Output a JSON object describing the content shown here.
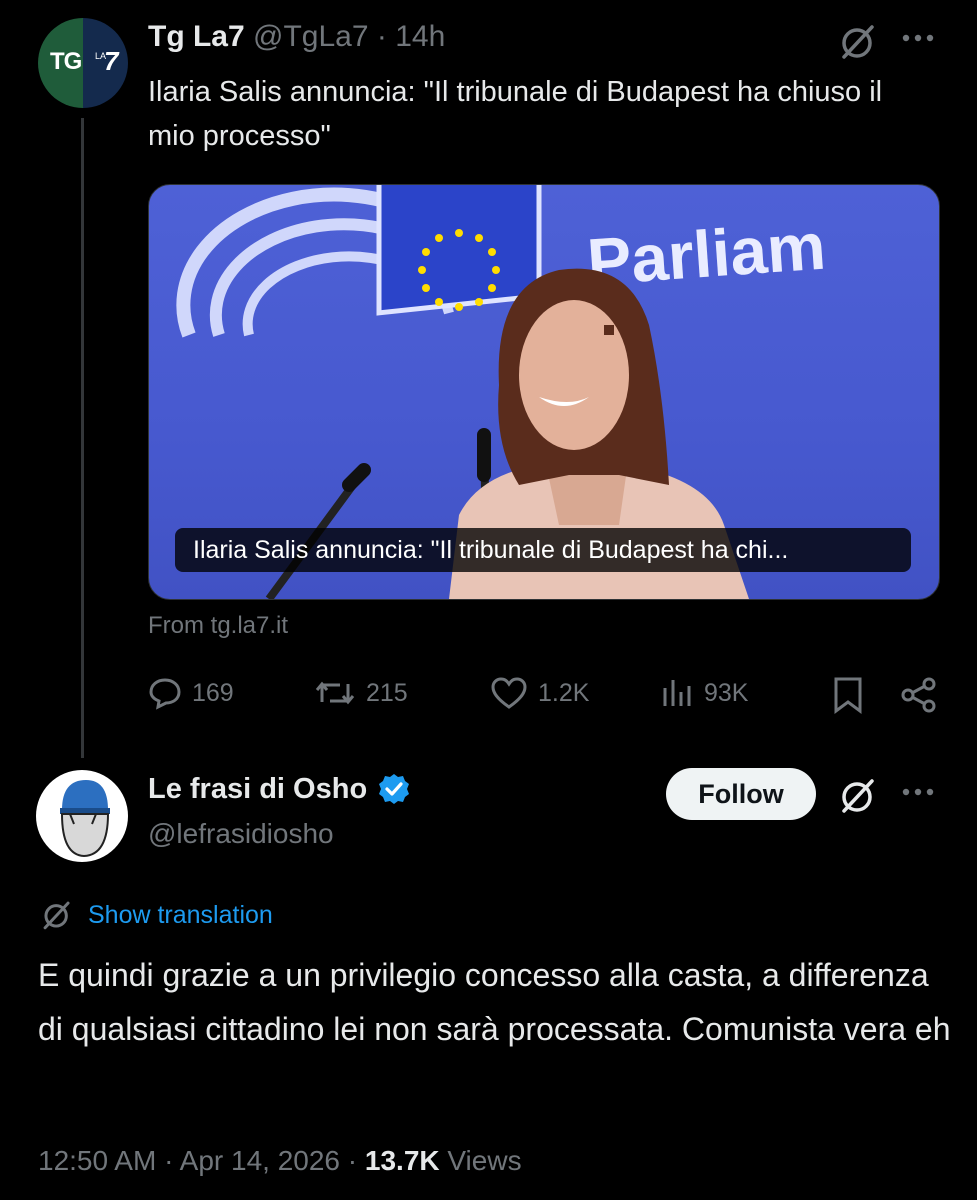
{
  "quoted_tweet": {
    "author_name": "Tg La7",
    "author_handle": "@TgLa7",
    "separator": "·",
    "time": "14h",
    "avatar_text_main": "TG",
    "avatar_text_small": "LA",
    "avatar_text_seven": "7",
    "text": "Ilaria Salis annuncia: \"Il tribunale di Budapest ha chiuso il mio processo\"",
    "card": {
      "image_sign_text": "Parliam",
      "caption": "Ilaria Salis annuncia: \"Il tribunale di Budapest ha chi...",
      "source": "From tg.la7.it"
    },
    "stats": {
      "replies": "169",
      "reposts": "215",
      "likes": "1.2K",
      "views": "93K"
    }
  },
  "reply_tweet": {
    "author_name": "Le frasi di Osho",
    "author_handle": "@lefrasidiosho",
    "follow_label": "Follow",
    "show_translation_label": "Show translation",
    "text": "E quindi grazie a un privilegio concesso alla casta, a differenza di qualsiasi cittadino lei non sarà processata. Comunista vera eh",
    "time": "12:50 AM",
    "separator": "·",
    "date": "Apr 14, 2026",
    "view_count": "13.7K",
    "views_label": "Views"
  },
  "colors": {
    "background": "#000000",
    "text": "#e7e9ea",
    "muted": "#71767b",
    "link": "#1d9bf0",
    "verified": "#1d9bf0"
  },
  "icons": [
    "grok-icon",
    "more-icon",
    "reply-icon",
    "repost-icon",
    "like-icon",
    "views-icon",
    "bookmark-icon",
    "share-icon",
    "verified-badge-icon",
    "translate-icon"
  ]
}
